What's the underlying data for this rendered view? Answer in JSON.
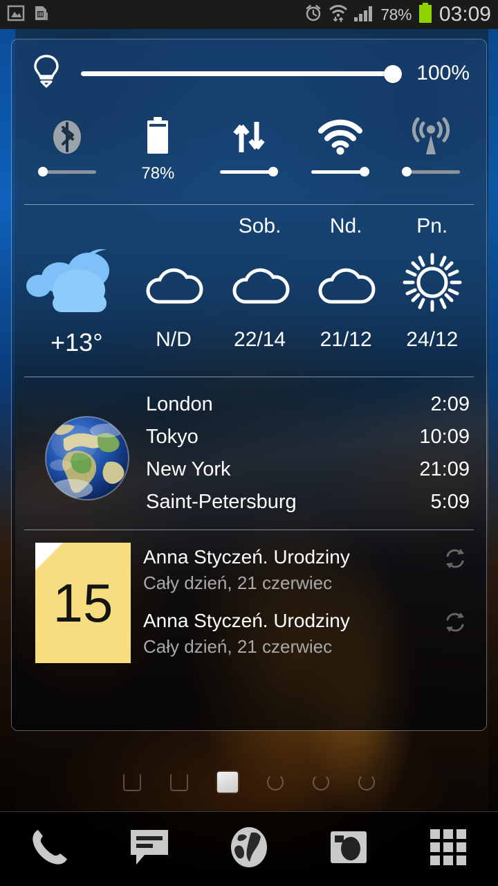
{
  "statusbar": {
    "left_icons": [
      "gallery-image-icon",
      "sd-card-icon"
    ],
    "right_icons": [
      "alarm-clock-icon",
      "wifi-data-transfer-icon",
      "cellular-signal-icon"
    ],
    "battery_percent": "78%",
    "clock": "03:09"
  },
  "quick_panel": {
    "brightness": {
      "icon": "light-bulb-icon",
      "value": "100%"
    },
    "toggles": [
      {
        "name": "bluetooth",
        "icon": "bluetooth-icon",
        "state": "off",
        "sub_label": ""
      },
      {
        "name": "battery",
        "icon": "battery-icon",
        "state": "none",
        "sub_label": "78%"
      },
      {
        "name": "data-sync",
        "icon": "data-sync-arrows-icon",
        "state": "on",
        "sub_label": ""
      },
      {
        "name": "wifi",
        "icon": "wifi-icon",
        "state": "on",
        "sub_label": ""
      },
      {
        "name": "hotspot",
        "icon": "cell-tower-icon",
        "state": "off",
        "sub_label": ""
      }
    ]
  },
  "weather": {
    "current": {
      "day": "",
      "icon": "cloudy-night-icon",
      "temp": "+13°"
    },
    "forecast": [
      {
        "day": "",
        "icon": "cloud-icon",
        "temp": "N/D"
      },
      {
        "day": "Sob.",
        "icon": "cloud-icon",
        "temp": "22/14"
      },
      {
        "day": "Nd.",
        "icon": "cloud-icon",
        "temp": "21/12"
      },
      {
        "day": "Pn.",
        "icon": "sun-icon",
        "temp": "24/12"
      }
    ]
  },
  "world_clock": {
    "icon": "earth-globe-icon",
    "cities": [
      {
        "city": "London",
        "time": "2:09"
      },
      {
        "city": "Tokyo",
        "time": "10:09"
      },
      {
        "city": "New York",
        "time": "21:09"
      },
      {
        "city": "Saint-Petersburg",
        "time": "5:09"
      }
    ]
  },
  "calendar": {
    "day_number": "15",
    "note_color": "#f7dd80",
    "events": [
      {
        "title": "Anna Styczeń. Urodziny",
        "detail": "Cały dzień, 21 czerwiec",
        "repeat_icon": "repeat-icon"
      },
      {
        "title": "Anna Styczeń. Urodziny",
        "detail": "Cały dzień, 21 czerwiec",
        "repeat_icon": "repeat-icon"
      }
    ]
  },
  "home": {
    "page_count": 6,
    "active_page": 3
  },
  "dock": {
    "items": [
      {
        "name": "phone",
        "icon": "phone-icon"
      },
      {
        "name": "messages",
        "icon": "message-bubble-icon"
      },
      {
        "name": "browser",
        "icon": "globe-browser-icon"
      },
      {
        "name": "camera",
        "icon": "camera-icon"
      },
      {
        "name": "app-drawer",
        "icon": "apps-grid-icon"
      }
    ]
  },
  "colors": {
    "panel_tint": "#164170",
    "accent_white": "#ffffff",
    "battery_green": "#8fd400",
    "calendar_yellow": "#f7dd80"
  }
}
